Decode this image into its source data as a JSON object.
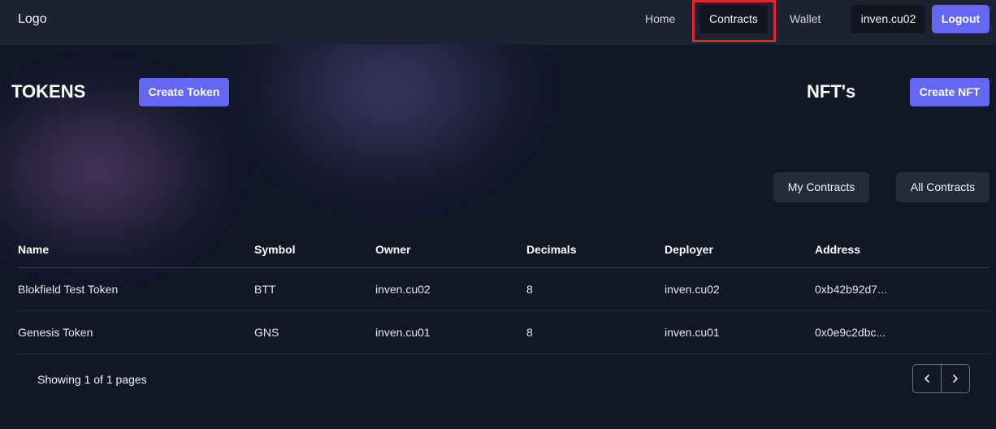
{
  "nav": {
    "logo": "Logo",
    "home": "Home",
    "contracts": "Contracts",
    "wallet": "Wallet",
    "user": "inven.cu02",
    "logout": "Logout"
  },
  "tokens_section": {
    "title": "TOKENS",
    "create_label": "Create Token"
  },
  "nft_section": {
    "title": "NFT's",
    "create_label": "Create NFT"
  },
  "filters": {
    "my_contracts": "My Contracts",
    "all_contracts": "All Contracts"
  },
  "table": {
    "columns": [
      "Name",
      "Symbol",
      "Owner",
      "Decimals",
      "Deployer",
      "Address"
    ],
    "rows": [
      [
        "Blokfield Test Token",
        "BTT",
        "inven.cu02",
        "8",
        "inven.cu02",
        "0xb42b92d7..."
      ],
      [
        "Genesis Token",
        "GNS",
        "inven.cu01",
        "8",
        "inven.cu01",
        "0x0e9c2dbc..."
      ]
    ]
  },
  "pagination": {
    "text": "Showing 1 of 1 pages",
    "prev_icon": "chevron-left-icon",
    "next_icon": "chevron-right-icon"
  },
  "colors": {
    "accent": "#6467f2",
    "highlight": "#e0262b",
    "background": "#121728",
    "navbar": "#1c2231"
  }
}
